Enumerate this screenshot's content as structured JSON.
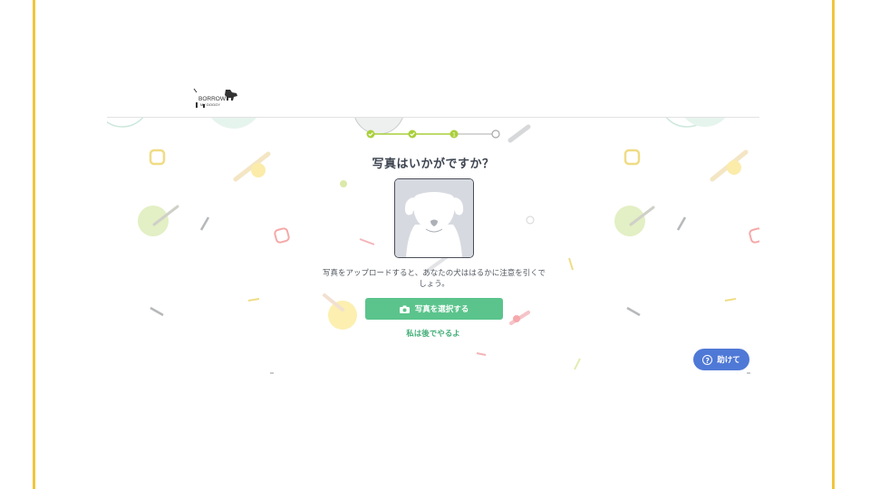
{
  "brand": {
    "logo_line1": "BORROW",
    "logo_line2": "MY DOGGY"
  },
  "stepper": {
    "steps": [
      "done",
      "done",
      "current",
      "upcoming"
    ],
    "current_marker": "1"
  },
  "main": {
    "title": "写真はいかがですか？",
    "description": "写真をアップロードすると、あなたの犬ははるかに注意を引くでしょう。",
    "select_button_label": "写真を選択する",
    "later_link_label": "私は後でやるよ"
  },
  "help": {
    "label": "助けて",
    "icon": "question-circle-icon"
  },
  "colors": {
    "accent_green": "#5bc48c",
    "stepper_green": "#a9cf3b",
    "help_blue": "#4f79d6",
    "edge_yellow": "#f0c63c"
  }
}
